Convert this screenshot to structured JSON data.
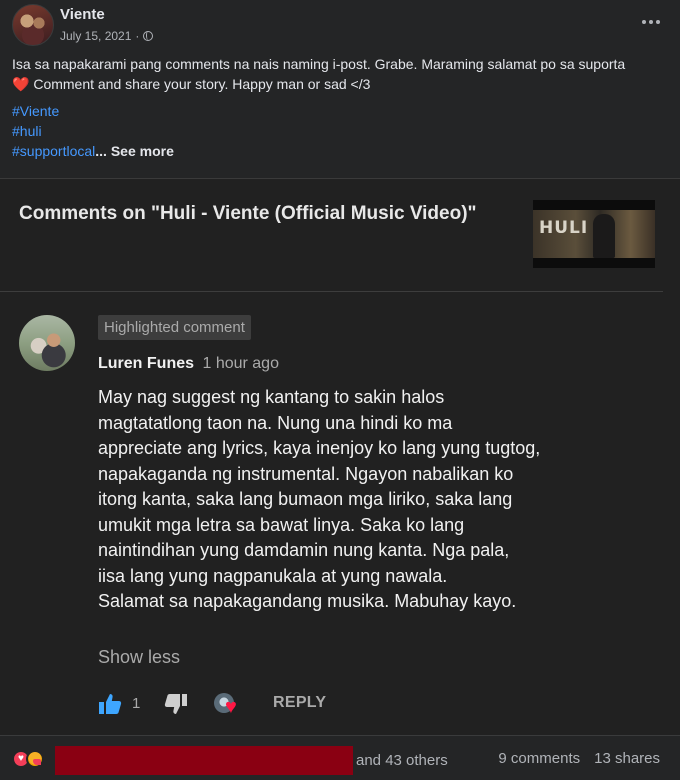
{
  "post": {
    "page_name": "Viente",
    "date": "July 15, 2021",
    "separator": "·",
    "body_line1": "Isa sa napakarami pang comments na nais naming i-post. Grabe. Maraming salamat po sa suporta",
    "body_line2": "Comment and share your story. Happy man or sad </3",
    "heart_emoji": "❤️",
    "hashtags": [
      "#Viente",
      "#huli",
      "#supportlocal"
    ],
    "ellipsis": "...",
    "see_more": "See more"
  },
  "shared_card": {
    "title": "Comments on \"Huli - Viente (Official Music Video)\"",
    "thumbnail_text": "HULI",
    "comment": {
      "badge": "Highlighted comment",
      "author": "Luren Funes",
      "time": "1 hour ago",
      "text_lines": [
        "May nag suggest ng kantang to sakin halos",
        "magtatatlong taon na. Nung una hindi ko ma",
        "appreciate ang lyrics, kaya inenjoy ko lang yung tugtog,",
        "napakaganda ng instrumental. Ngayon nabalikan ko",
        "itong kanta, saka lang bumaon mga liriko, saka lang",
        "umukit mga letra sa bawat linya. Saka ko lang",
        "naintindihan yung damdamin nung kanta. Nga pala,",
        "iisa lang yung nagpanukala at yung nawala.",
        "Salamat sa napakagandang musika. Mabuhay kayo."
      ],
      "show_less": "Show less",
      "like_count": "1",
      "reply": "REPLY",
      "creator_heart": "♥"
    }
  },
  "footer": {
    "reactions": [
      "love",
      "care"
    ],
    "and_others": "and 43 others",
    "comments": "9 comments",
    "shares": "13 shares"
  },
  "colors": {
    "background": "#242526",
    "card_background": "#212121",
    "hashtag": "#4599ff",
    "heart": "#f02849",
    "like_blue": "#3ea6ff",
    "redaction": "#8a0012"
  }
}
